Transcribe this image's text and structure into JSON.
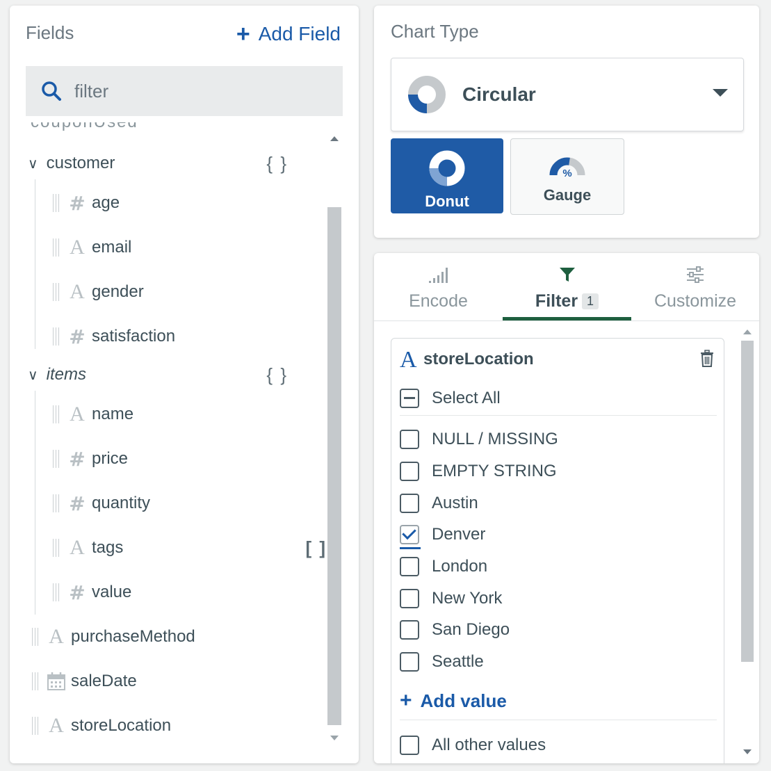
{
  "fields_panel": {
    "title": "Fields",
    "add_field_label": "Add Field",
    "filter_placeholder": "filter",
    "cut_off_item": "couponUsed",
    "groups": [
      {
        "name": "customer",
        "brace": "{ }",
        "children": [
          {
            "type": "number",
            "name": "age"
          },
          {
            "type": "string",
            "name": "email"
          },
          {
            "type": "string",
            "name": "gender"
          },
          {
            "type": "number",
            "name": "satisfaction"
          }
        ]
      },
      {
        "name": "items",
        "brace": "{ }",
        "children": [
          {
            "type": "string",
            "name": "name"
          },
          {
            "type": "number",
            "name": "price"
          },
          {
            "type": "number",
            "name": "quantity"
          },
          {
            "type": "string",
            "name": "tags",
            "array_badge": "[ ]"
          },
          {
            "type": "number",
            "name": "value"
          }
        ]
      }
    ],
    "top_level": [
      {
        "type": "string",
        "name": "purchaseMethod"
      },
      {
        "type": "date",
        "name": "saleDate"
      },
      {
        "type": "string",
        "name": "storeLocation"
      }
    ]
  },
  "chart_type": {
    "title": "Chart Type",
    "selected": "Circular",
    "subtypes": [
      {
        "label": "Donut",
        "active": true
      },
      {
        "label": "Gauge",
        "active": false
      }
    ]
  },
  "filter_panel": {
    "tabs": [
      {
        "label": "Encode"
      },
      {
        "label": "Filter",
        "badge": "1"
      },
      {
        "label": "Customize"
      }
    ],
    "active_tab": "Filter",
    "field": {
      "type_icon": "A",
      "name": "storeLocation"
    },
    "select_all_label": "Select All",
    "values": [
      {
        "label": "NULL / MISSING",
        "checked": false
      },
      {
        "label": "EMPTY STRING",
        "checked": false
      },
      {
        "label": "Austin",
        "checked": false
      },
      {
        "label": "Denver",
        "checked": true
      },
      {
        "label": "London",
        "checked": false
      },
      {
        "label": "New York",
        "checked": false
      },
      {
        "label": "San Diego",
        "checked": false
      },
      {
        "label": "Seattle",
        "checked": false
      }
    ],
    "add_value_label": "Add value",
    "all_other_values_label": "All other values"
  },
  "colors": {
    "accent_blue": "#1a5aa8",
    "donut_active_bg": "#1f5ba6",
    "tab_underline": "#1e5f3f"
  },
  "icons": {
    "add": "plus-icon",
    "search": "search-icon",
    "string_type": "string-type-icon",
    "number_type": "number-type-icon",
    "date_type": "calendar-icon",
    "trash": "trash-icon"
  }
}
